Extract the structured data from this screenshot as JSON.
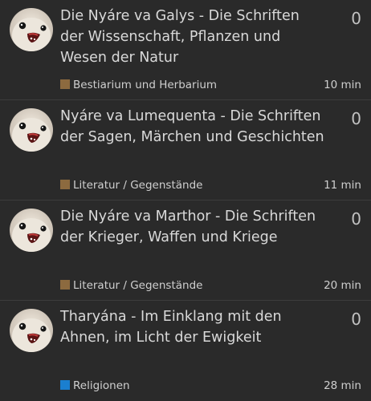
{
  "topics": [
    {
      "title": "Die Nyáre va Galys - Die Schriften der Wissenschaft, Pflanzen und Wesen der Natur",
      "replies": "0",
      "category": "Bestiarium und Herbarium",
      "category_color": "#8c6a3f",
      "activity": "10 min"
    },
    {
      "title": "Nyáre va Lumequenta - Die Schriften der Sagen, Märchen und Geschichten",
      "replies": "0",
      "category": "Literatur / Gegenstände",
      "category_color": "#8c6a3f",
      "activity": "11 min"
    },
    {
      "title": "Die Nyáre va Marthor - Die Schriften der Krieger, Waffen und Kriege",
      "replies": "0",
      "category": "Literatur / Gegenstände",
      "category_color": "#8c6a3f",
      "activity": "20 min"
    },
    {
      "title": "Tharyána - Im Einklang mit den Ahnen, im Licht der Ewigkeit",
      "replies": "0",
      "category": "Religionen",
      "category_color": "#1a7fd0",
      "activity": "28 min"
    }
  ],
  "avatar_icon": "bird-avatar-icon"
}
